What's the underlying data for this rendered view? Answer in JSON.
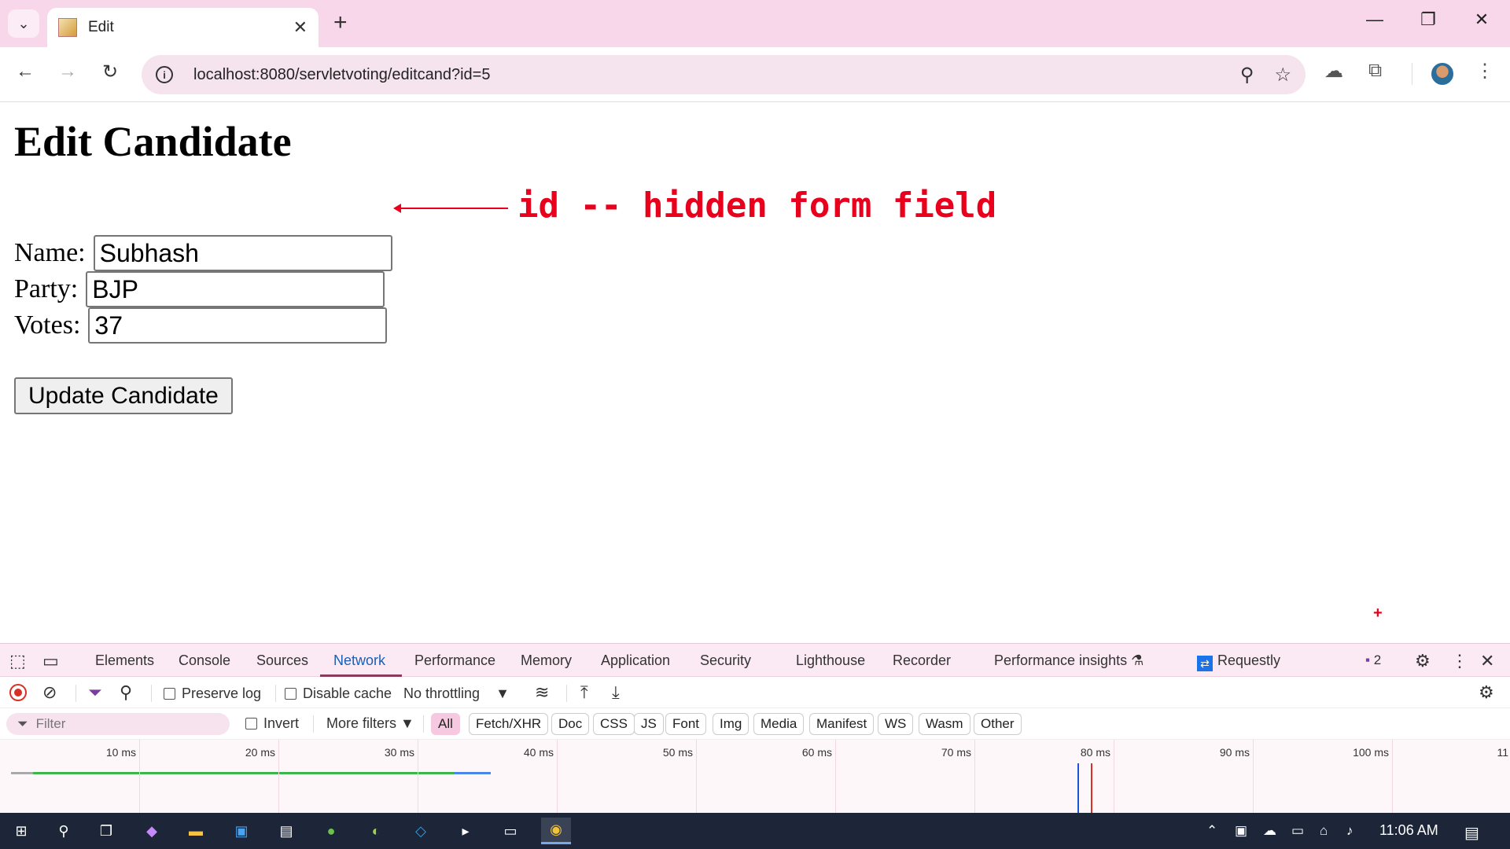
{
  "browser": {
    "tab_title": "Edit",
    "url": "localhost:8080/servletvoting/editcand?id=5"
  },
  "page": {
    "heading": "Edit Candidate",
    "form": {
      "name_label": "Name:",
      "name_value": "Subhash",
      "party_label": "Party:",
      "party_value": "BJP",
      "votes_label": "Votes:",
      "votes_value": "37",
      "submit_label": "Update Candidate"
    },
    "annotation": "id -- hidden form field",
    "annotation_color": "#e8001c"
  },
  "devtools": {
    "tabs": [
      "Elements",
      "Console",
      "Sources",
      "Network",
      "Performance",
      "Memory",
      "Application",
      "Security",
      "Lighthouse",
      "Recorder",
      "Performance insights",
      "Requestly"
    ],
    "active_tab": "Network",
    "issues_count": "2",
    "preserve_log": "Preserve log",
    "disable_cache": "Disable cache",
    "throttling": "No throttling",
    "filter_placeholder": "Filter",
    "invert": "Invert",
    "more_filters": "More filters",
    "type_filters": [
      "All",
      "Fetch/XHR",
      "Doc",
      "CSS",
      "JS",
      "Font",
      "Img",
      "Media",
      "Manifest",
      "WS",
      "Wasm",
      "Other"
    ],
    "active_type_filter": "All",
    "timeline_ticks": [
      "10 ms",
      "20 ms",
      "30 ms",
      "40 ms",
      "50 ms",
      "60 ms",
      "70 ms",
      "80 ms",
      "90 ms",
      "100 ms",
      "11"
    ],
    "dom_content_loaded_ms": 80,
    "load_ms": 81
  },
  "taskbar": {
    "time": "11:06 AM",
    "background": "#1d2538"
  }
}
